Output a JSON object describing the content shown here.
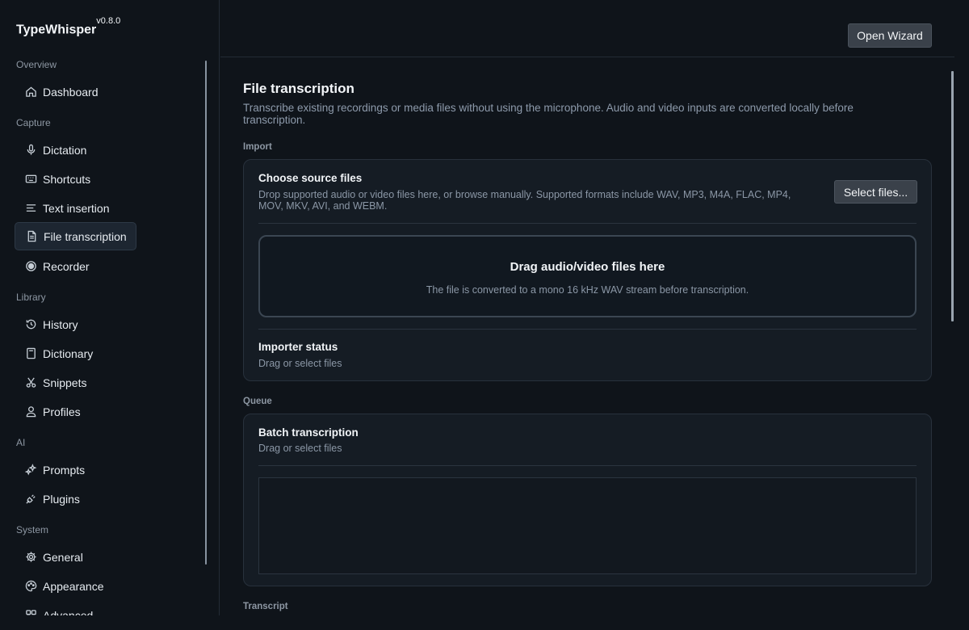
{
  "app": {
    "name": "TypeWhisper",
    "version": "v0.8.0"
  },
  "header": {
    "open_wizard": "Open Wizard"
  },
  "sidebar": {
    "sections": [
      {
        "label": "Overview",
        "items": [
          {
            "label": "Dashboard",
            "icon": "home-icon"
          }
        ]
      },
      {
        "label": "Capture",
        "items": [
          {
            "label": "Dictation",
            "icon": "microphone-icon"
          },
          {
            "label": "Shortcuts",
            "icon": "keyboard-icon"
          },
          {
            "label": "Text insertion",
            "icon": "text-lines-icon"
          },
          {
            "label": "File transcription",
            "icon": "file-icon",
            "active": true
          },
          {
            "label": "Recorder",
            "icon": "record-icon"
          }
        ]
      },
      {
        "label": "Library",
        "items": [
          {
            "label": "History",
            "icon": "history-icon"
          },
          {
            "label": "Dictionary",
            "icon": "book-icon"
          },
          {
            "label": "Snippets",
            "icon": "scissors-icon"
          },
          {
            "label": "Profiles",
            "icon": "user-icon"
          }
        ]
      },
      {
        "label": "AI",
        "items": [
          {
            "label": "Prompts",
            "icon": "sparkles-icon"
          },
          {
            "label": "Plugins",
            "icon": "plug-icon"
          }
        ]
      },
      {
        "label": "System",
        "items": [
          {
            "label": "General",
            "icon": "gear-icon"
          },
          {
            "label": "Appearance",
            "icon": "palette-icon"
          },
          {
            "label": "Advanced",
            "icon": "advanced-icon"
          }
        ]
      }
    ]
  },
  "main": {
    "title": "File transcription",
    "description": "Transcribe existing recordings or media files without using the microphone. Audio and video inputs are converted locally before transcription.",
    "import": {
      "label": "Import",
      "card_title": "Choose source files",
      "card_desc": "Drop supported audio or video files here, or browse manually. Supported formats include WAV, MP3, M4A, FLAC, MP4, MOV, MKV, AVI, and WEBM.",
      "select_button": "Select files...",
      "dropzone_title": "Drag audio/video files here",
      "dropzone_sub": "The file is converted to a mono 16 kHz WAV stream before transcription.",
      "status_title": "Importer status",
      "status_value": "Drag or select files"
    },
    "queue": {
      "label": "Queue",
      "card_title": "Batch transcription",
      "card_desc": "Drag or select files"
    },
    "transcript": {
      "label": "Transcript"
    }
  },
  "colors": {
    "background": "#0f141a",
    "card": "#151c24",
    "border": "#28313c",
    "muted_text": "#8b97a6"
  }
}
